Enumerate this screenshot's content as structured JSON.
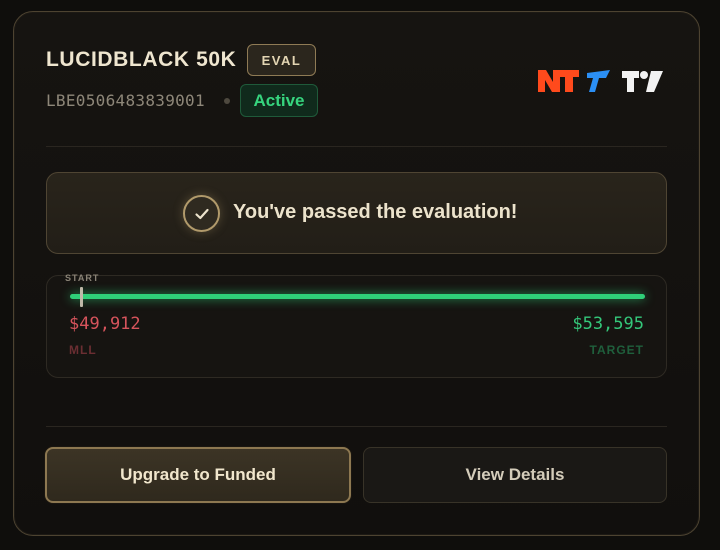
{
  "account": {
    "name": "LUCIDBLACK 50K",
    "type_badge": "EVAL",
    "id": "LBE0506483839001",
    "status": "Active"
  },
  "platforms": {
    "icons": [
      "ninjatrader-icon",
      "tradovate-icon",
      "tradingview-icon"
    ]
  },
  "banner": {
    "message": "You've passed the evaluation!",
    "icon": "check-circle-icon"
  },
  "progress": {
    "start_label": "START",
    "mll_value": "$49,912",
    "mll_label": "MLL",
    "target_value": "$53,595",
    "target_label": "TARGET",
    "fill_fraction": 1.0
  },
  "actions": {
    "primary_label": "Upgrade to Funded",
    "secondary_label": "View Details"
  },
  "colors": {
    "accent_gold": "#8d7851",
    "success_green": "#2fcf78",
    "danger_red": "#d7545c",
    "ninjatrader_orange": "#ff4a1c",
    "tradovate_blue": "#2b8ff5"
  }
}
